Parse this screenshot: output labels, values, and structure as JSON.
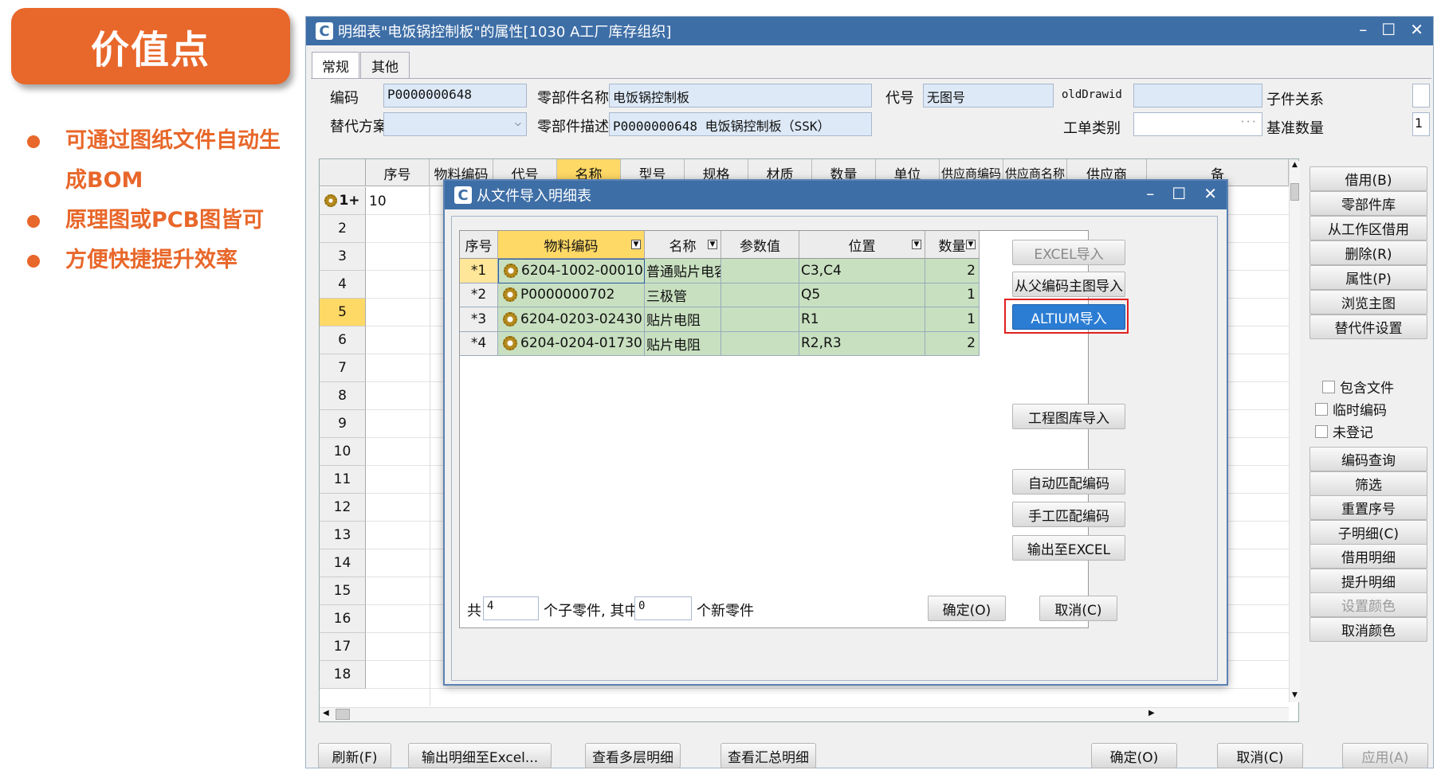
{
  "slide": {
    "badge": "价值点",
    "bullets": [
      "可通过图纸文件自动生成BOM",
      "原理图或PCB图皆可",
      "方便快捷提升效率"
    ]
  },
  "window": {
    "title": "明细表\"电饭锅控制板\"的属性[1030 A工厂库存组织]",
    "tabs": [
      "常规",
      "其他"
    ]
  },
  "form": {
    "code_label": "编码",
    "code_value": "P0000000648",
    "part_name_label": "零部件名称",
    "part_name_value": "电饭锅控制板",
    "alias_label": "代号",
    "alias_value": "无图号",
    "olddrawid_label": "oldDrawid",
    "olddrawid_value": "",
    "child_rel_label": "子件关系",
    "alt_plan_label": "替代方案",
    "alt_plan_value": "",
    "part_desc_label": "零部件描述",
    "part_desc_value": "P0000000648 电饭锅控制板（SSK）",
    "order_type_label": "工单类别",
    "order_type_value": "",
    "base_qty_label": "基准数量",
    "base_qty_value": "1"
  },
  "main_grid": {
    "columns": [
      "序号",
      "物料编码",
      "代号",
      "名称",
      "型号",
      "规格",
      "材质",
      "数量",
      "单位",
      "供应商编码",
      "供应商名称",
      "供应商",
      "备"
    ],
    "row_numbers": [
      "1+",
      "2",
      "3",
      "4",
      "5",
      "6",
      "7",
      "8",
      "9",
      "10",
      "11",
      "12",
      "13",
      "14",
      "15",
      "16",
      "17",
      "18"
    ],
    "first_row_seq": "10",
    "selected_row": "5"
  },
  "side_buttons": [
    "借用(B)",
    "零部件库",
    "从工作区借用",
    "删除(R)",
    "属性(P)",
    "浏览主图",
    "替代件设置"
  ],
  "side_checks": [
    "包含文件",
    "临时编码",
    "未登记"
  ],
  "side_buttons2": [
    "编码查询",
    "筛选",
    "重置序号",
    "子明细(C)",
    "借用明细",
    "提升明细",
    "设置颜色",
    "取消颜色"
  ],
  "bottom_buttons": {
    "refresh": "刷新(F)",
    "export_excel": "输出明细至Excel...",
    "multi_level": "查看多层明细",
    "summary": "查看汇总明细",
    "ok": "确定(O)",
    "cancel": "取消(C)",
    "apply": "应用(A)"
  },
  "dialog": {
    "title": "从文件导入明细表",
    "columns": [
      "序号",
      "物料编码",
      "名称",
      "参数值",
      "位置",
      "数量"
    ],
    "rows": [
      {
        "seq": "*1",
        "code": "6204-1002-00010",
        "name": "普通贴片电容",
        "param": "",
        "pos": "C3,C4",
        "qty": "2"
      },
      {
        "seq": "*2",
        "code": "P0000000702",
        "name": "三极管",
        "param": "",
        "pos": "Q5",
        "qty": "1"
      },
      {
        "seq": "*3",
        "code": "6204-0203-02430",
        "name": "贴片电阻",
        "param": "",
        "pos": "R1",
        "qty": "1"
      },
      {
        "seq": "*4",
        "code": "6204-0204-01730",
        "name": "贴片电阻",
        "param": "",
        "pos": "R2,R3",
        "qty": "2"
      }
    ],
    "buttons": {
      "excel_import": "EXCEL导入",
      "parent_import": "从父编码主图导入",
      "altium_import": "ALTIUM导入",
      "lib_import": "工程图库导入",
      "auto_match": "自动匹配编码",
      "manual_match": "手工匹配编码",
      "export_excel": "输出至EXCEL",
      "ok": "确定(O)",
      "cancel": "取消(C)"
    },
    "footer": {
      "total_label": "共",
      "total_value": "4",
      "mid_label": "个子零件, 其中",
      "new_value": "0",
      "new_label": "个新零件"
    }
  }
}
